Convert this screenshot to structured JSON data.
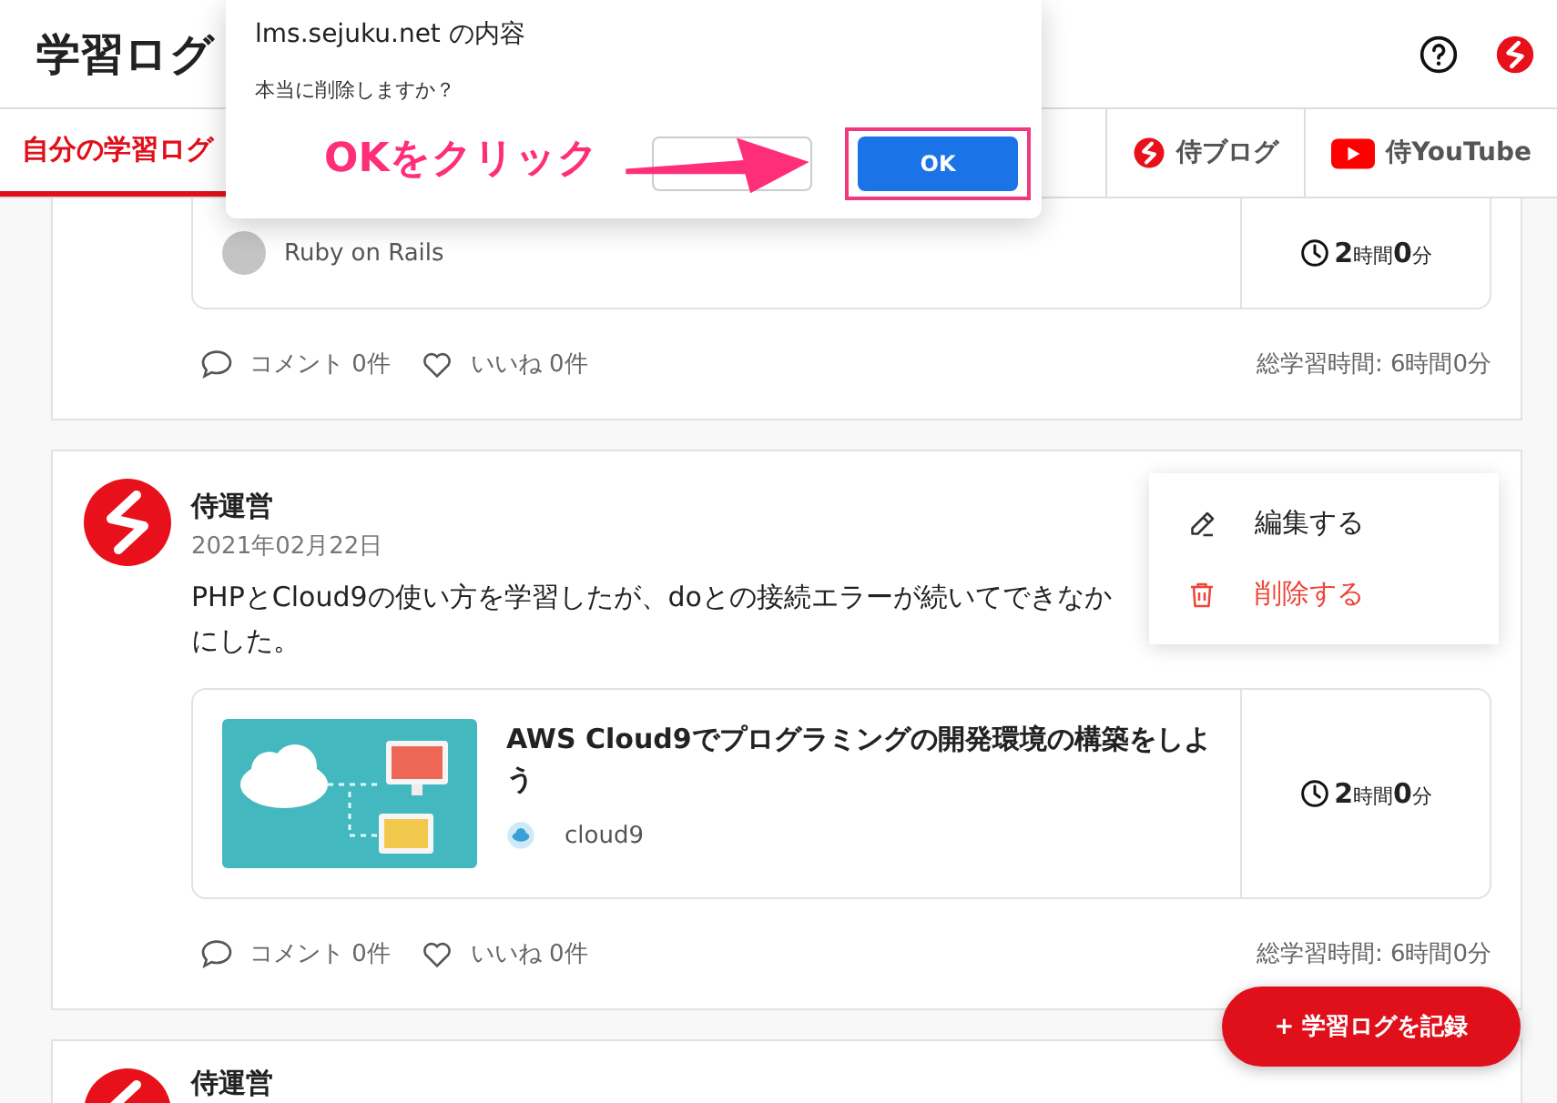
{
  "header": {
    "title": "学習ログ"
  },
  "tabs": [
    {
      "label": "自分の学習ログ",
      "selected": true
    }
  ],
  "external_links": [
    {
      "label": "侍ブログ",
      "kind": "blog"
    },
    {
      "label": "侍YouTube",
      "kind": "youtube"
    }
  ],
  "posts": [
    {
      "materials": [
        {
          "kind": "plain",
          "tag": "Ruby on Rails",
          "time": "**2**時間**0**分"
        }
      ],
      "comments": "コメント 0件",
      "likes": "いいね 0件",
      "total": "総学習時間: 6時間0分"
    },
    {
      "author": "侍運営",
      "date": "2021年02月22日",
      "body_lines": [
        "PHPとCloud9の使い方を学習したが、doとの接続エラーが続いてできなか",
        "にした。"
      ],
      "materials": [
        {
          "title": "AWS Cloud9でプログラミングの開発環境の構築をしよう",
          "kind": "course",
          "tag": "cloud9",
          "time": "**2**時間**0**分"
        }
      ],
      "comments": "コメント 0件",
      "likes": "いいね 0件",
      "total": "総学習時間: 6時間0分",
      "menu": [
        {
          "label": "編集する",
          "kind": "edit"
        },
        {
          "label": "削除する",
          "kind": "delete"
        }
      ]
    },
    {
      "author": "侍運営"
    }
  ],
  "dialog": {
    "origin": "lms.sejuku.net の内容",
    "message": "本当に削除しますか？",
    "ok": "OK"
  },
  "annotation": "OKをクリック",
  "fab": "+ 学習ログを記録"
}
